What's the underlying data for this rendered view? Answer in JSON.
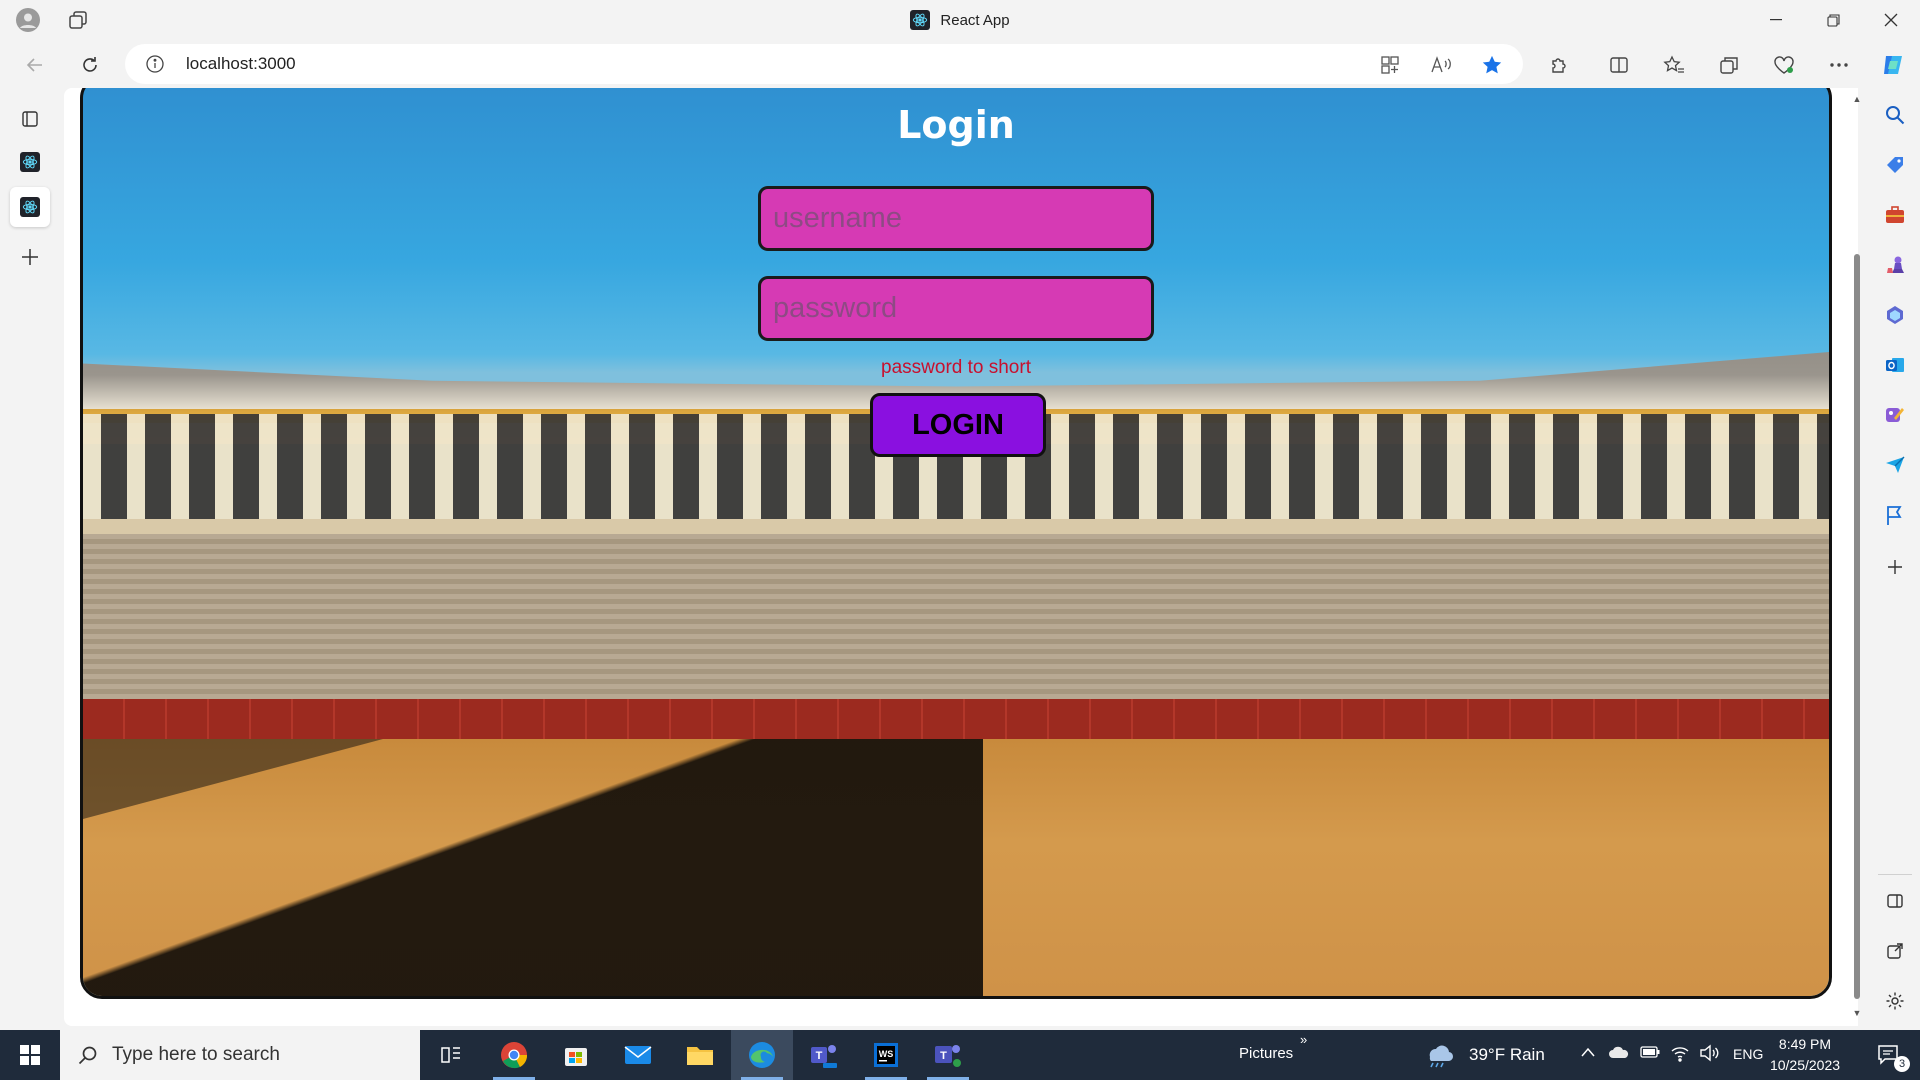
{
  "window": {
    "title": "React App",
    "minimize_icon": "minimize-icon",
    "maximize_icon": "restore-icon",
    "close_icon": "close-icon"
  },
  "addressbar": {
    "url": "localhost:3000",
    "favorite_color": "#1a73e8"
  },
  "vertical_tabs": [
    {
      "name": "React App",
      "icon": "react-icon",
      "active": false
    },
    {
      "name": "React App",
      "icon": "react-icon",
      "active": true
    }
  ],
  "page": {
    "heading": "Login",
    "username_placeholder": "username",
    "password_placeholder": "password",
    "error_text": "password to short",
    "login_button": "LOGIN",
    "colors": {
      "field_bg": "#d63ab4",
      "button_bg": "#8a10e0",
      "error": "#c8102e",
      "heading": "#ffffff"
    }
  },
  "taskbar": {
    "search_placeholder": "Type here to search",
    "folder_label": "Pictures",
    "weather": "39°F  Rain",
    "language": "ENG",
    "time": "8:49 PM",
    "date": "10/25/2023",
    "notification_count": "3"
  }
}
